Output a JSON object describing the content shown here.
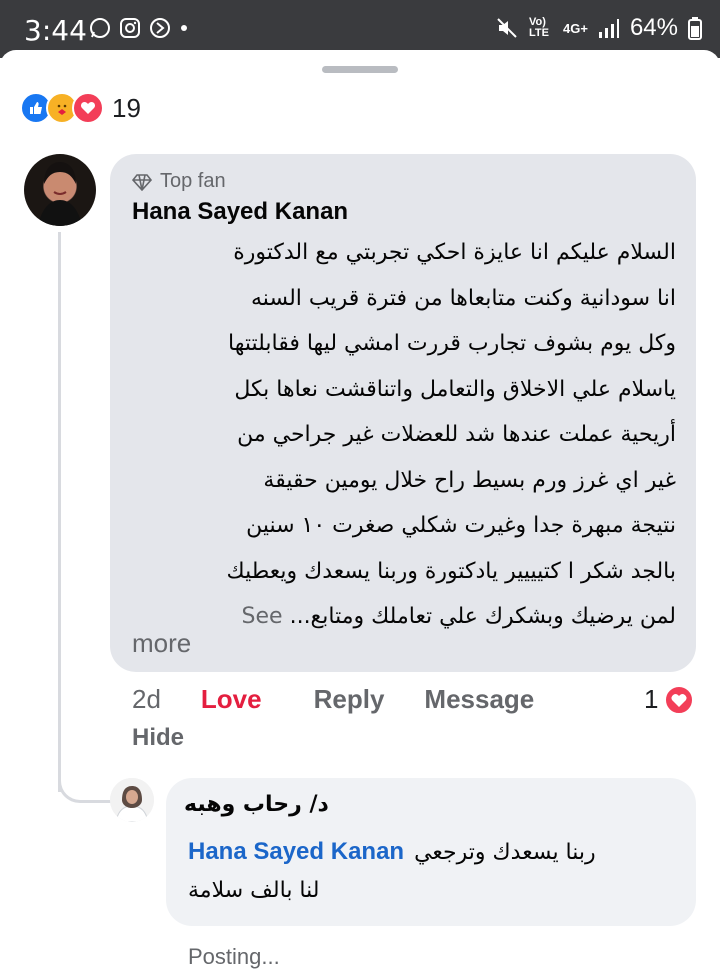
{
  "status_bar": {
    "time": "3:44",
    "network_label": "Vo) LTE",
    "network_type": "4G+",
    "battery": "64%"
  },
  "post": {
    "reaction_count": "19",
    "reactions": [
      "like-icon",
      "care-icon",
      "love-icon"
    ]
  },
  "comment": {
    "badge": "Top fan",
    "author": "Hana Sayed Kanan",
    "lines": [
      "السلام عليكم انا عايزة احكي تجربتي  مع الدكتورة",
      "انا سودانية وكنت متابعاها  من فترة قريب السنه",
      "وكل يوم بشوف تجارب قررت  امشي ليها فقابلتتها",
      "ياسلام علي الاخلاق والتعامل واتناقشت نعاها بكل",
      "أريحية   عملت عندها شد للعضلات  غير جراحي من",
      "غير اي غرز   ورم بسيط راح خلال يومين حقيقة",
      "نتيجة مبهرة جدا وغيرت شكلي  صغرت ١٠ سنين",
      "بالجد شكر ا كتيييير يادكتورة وربنا يسعدك ويعطيك",
      "لمن يرضيك   وبشكرك علي تعاملك ومتابع..."
    ],
    "see": "See",
    "more": "more",
    "time": "2d",
    "love_label": "Love",
    "reply_label": "Reply",
    "message_label": "Message",
    "like_count": "1",
    "hide_label": "Hide"
  },
  "reply": {
    "author": "د/ رحاب وهبه",
    "mention": "Hana Sayed Kanan",
    "text_line1": "ربنا يسعدك وترجعي",
    "text_line2": "لنا بالف سلامة",
    "status": "Posting..."
  },
  "colors": {
    "bubble": "#e4e6eb",
    "love": "#e41e3f",
    "mention": "#1b66c9",
    "muted": "#65676b"
  }
}
